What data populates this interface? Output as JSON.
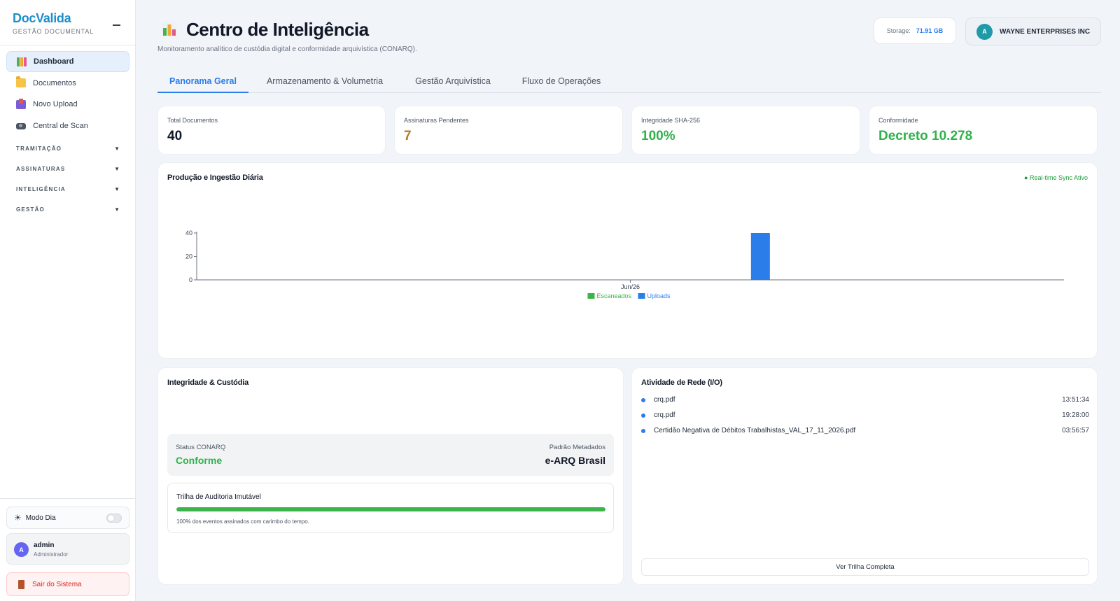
{
  "brand": {
    "title": "DocValida",
    "subtitle": "GESTÃO DOCUMENTAL"
  },
  "sidebar": {
    "items": [
      {
        "label": "Dashboard",
        "icon": "chart-icon"
      },
      {
        "label": "Documentos",
        "icon": "folder-icon"
      },
      {
        "label": "Novo Upload",
        "icon": "upload-icon"
      },
      {
        "label": "Central de Scan",
        "icon": "camera-icon"
      }
    ],
    "sections": [
      {
        "label": "TRAMITAÇÃO"
      },
      {
        "label": "ASSINATURAS"
      },
      {
        "label": "INTELIGÊNCIA"
      },
      {
        "label": "GESTÃO"
      }
    ],
    "mode_label": "Modo Dia",
    "user": {
      "initial": "A",
      "name": "admin",
      "role": "Administrador"
    },
    "logout_label": "Sair do Sistema"
  },
  "header": {
    "title": "Centro de Inteligência",
    "subtitle": "Monitoramento analítico de custódia digital e conformidade arquivística (CONARQ).",
    "storage_label": "Storage:",
    "storage_value": "71.91 GB",
    "company_initial": "A",
    "company_name": "WAYNE ENTERPRISES INC"
  },
  "tabs": [
    "Panorama Geral",
    "Armazenamento & Volumetria",
    "Gestão Arquivística",
    "Fluxo de Operações"
  ],
  "kpis": [
    {
      "label": "Total Documentos",
      "value": "40",
      "color": "#111827"
    },
    {
      "label": "Assinaturas Pendentes",
      "value": "7",
      "color": "#b7791f"
    },
    {
      "label": "Integridade SHA-256",
      "value": "100%",
      "color": "#2fb24a"
    },
    {
      "label": "Conformidade",
      "value": "Decreto 10.278",
      "color": "#2fb24a"
    }
  ],
  "production": {
    "title": "Produção e Ingestão Diária",
    "sync_label": "● Real-time Sync Ativo"
  },
  "chart_data": {
    "type": "bar",
    "title": "Produção e Ingestão Diária",
    "categories": [
      "Jun/26"
    ],
    "series": [
      {
        "name": "Escaneados",
        "values": [
          0
        ],
        "color": "#3cb44b"
      },
      {
        "name": "Uploads",
        "values": [
          40
        ],
        "color": "#2b7de9"
      }
    ],
    "yticks": [
      0,
      20,
      40
    ],
    "ylim": [
      0,
      40
    ],
    "legend": "bottom-center",
    "grid": false
  },
  "integrity": {
    "title": "Integridade & Custódia",
    "status_label": "Status CONARQ",
    "status_value": "Conforme",
    "standard_label": "Padrão Metadados",
    "standard_value": "e-ARQ Brasil",
    "audit_title": "Trilha de Auditoria Imutável",
    "audit_progress": 100,
    "audit_note": "100% dos eventos assinados com carimbo do tempo."
  },
  "activity": {
    "title": "Atividade de Rede (I/O)",
    "items": [
      {
        "name": "crq.pdf",
        "time": "13:51:34"
      },
      {
        "name": "crq.pdf",
        "time": "19:28:00"
      },
      {
        "name": "Certidão Negativa de Débitos Trabalhistas_VAL_17_11_2026.pdf",
        "time": "03:56:57"
      }
    ],
    "button_label": "Ver Trilha Completa"
  }
}
